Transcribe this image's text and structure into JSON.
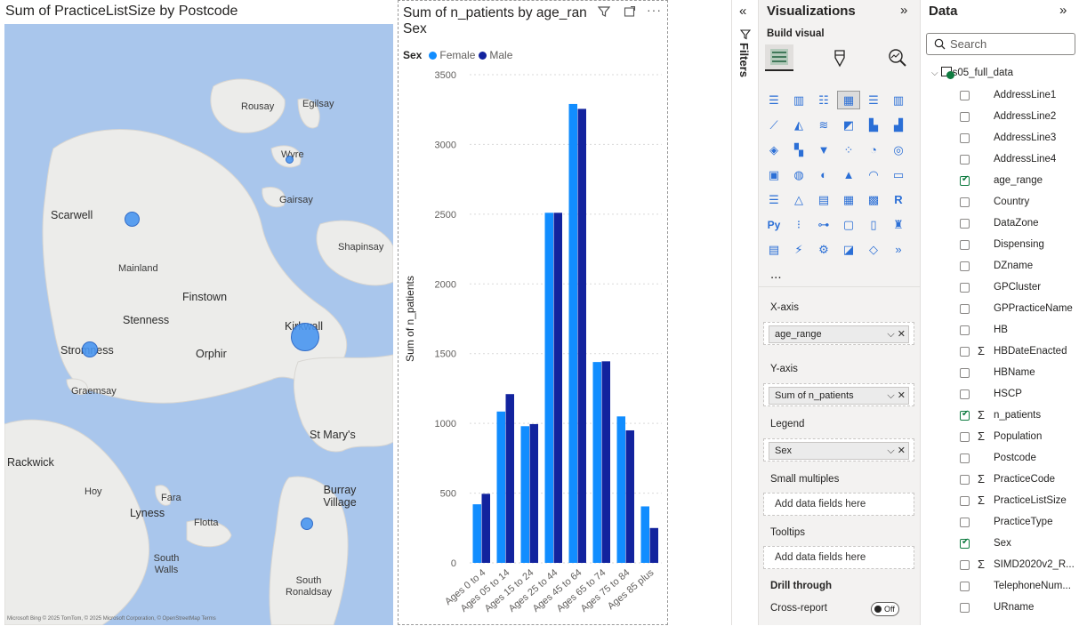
{
  "map": {
    "title": "Sum of PracticeListSize by Postcode",
    "places": [
      {
        "name": "Rousay",
        "size": "small"
      },
      {
        "name": "Egilsay",
        "size": "small"
      },
      {
        "name": "Wyre",
        "size": "small"
      },
      {
        "name": "Gairsay",
        "size": "small"
      },
      {
        "name": "Scarwell",
        "size": "big"
      },
      {
        "name": "Mainland",
        "size": "small"
      },
      {
        "name": "Shapinsay",
        "size": "small"
      },
      {
        "name": "Finstown",
        "size": "big"
      },
      {
        "name": "Stenness",
        "size": "big"
      },
      {
        "name": "Kirkwall",
        "size": "big"
      },
      {
        "name": "Stromness",
        "size": "big"
      },
      {
        "name": "Orphir",
        "size": "big"
      },
      {
        "name": "Graemsay",
        "size": "small"
      },
      {
        "name": "St Mary's",
        "size": "big"
      },
      {
        "name": "Rackwick",
        "size": "big"
      },
      {
        "name": "Burray Village",
        "size": "big"
      },
      {
        "name": "Hoy",
        "size": "small"
      },
      {
        "name": "Fara",
        "size": "small"
      },
      {
        "name": "Lyness",
        "size": "big"
      },
      {
        "name": "Flotta",
        "size": "small"
      },
      {
        "name": "South Walls",
        "size": "small"
      },
      {
        "name": "South Ronaldsay",
        "size": "small"
      }
    ],
    "footer": "Microsoft Bing    © 2025 TomTom, © 2025 Microsoft Corporation, © OpenStreetMap Terms"
  },
  "bar": {
    "title_line1": "Sum of n_patients by age_ran",
    "title_line2": "Sex",
    "legend_title": "Sex"
  },
  "chart_data": {
    "type": "bar",
    "title": "Sum of n_patients by age_range and Sex",
    "xlabel": "age_range",
    "ylabel": "Sum of n_patients",
    "ylim": [
      0,
      3500
    ],
    "yticks": [
      0,
      500,
      1000,
      1500,
      2000,
      2500,
      3000,
      3500
    ],
    "categories": [
      "Ages 0 to 4",
      "Ages 05 to 14",
      "Ages 15 to 24",
      "Ages 25 to 44",
      "Ages 45 to 64",
      "Ages 65 to 74",
      "Ages 75 to 84",
      "Ages 85 plus"
    ],
    "series": [
      {
        "name": "Female",
        "color": "#118DFF",
        "values": [
          420,
          1085,
          980,
          2510,
          3290,
          1440,
          1050,
          405
        ]
      },
      {
        "name": "Male",
        "color": "#12239E",
        "values": [
          495,
          1210,
          995,
          2510,
          3255,
          1445,
          950,
          250
        ]
      }
    ],
    "grid": true,
    "legend": "top-left"
  },
  "filters": {
    "label": "Filters",
    "collapse_icon": "double-chevron-left"
  },
  "viz": {
    "title": "Visualizations",
    "build_visual": "Build visual",
    "more": "...",
    "wells": [
      {
        "label": "X-axis",
        "value": "age_range"
      },
      {
        "label": "Y-axis",
        "value": "Sum of n_patients"
      },
      {
        "label": "Legend",
        "value": "Sex"
      },
      {
        "label": "Small multiples",
        "placeholder": "Add data fields here"
      },
      {
        "label": "Tooltips",
        "placeholder": "Add data fields here"
      }
    ],
    "drill_through": "Drill through",
    "cross_report": "Cross-report",
    "cross_report_state": "Off"
  },
  "data_pane": {
    "title": "Data",
    "search_placeholder": "Search",
    "table_name": "s05_full_data",
    "fields": [
      {
        "name": "AddressLine1",
        "checked": false,
        "sigma": false
      },
      {
        "name": "AddressLine2",
        "checked": false,
        "sigma": false
      },
      {
        "name": "AddressLine3",
        "checked": false,
        "sigma": false
      },
      {
        "name": "AddressLine4",
        "checked": false,
        "sigma": false
      },
      {
        "name": "age_range",
        "checked": true,
        "sigma": false
      },
      {
        "name": "Country",
        "checked": false,
        "sigma": false
      },
      {
        "name": "DataZone",
        "checked": false,
        "sigma": false
      },
      {
        "name": "Dispensing",
        "checked": false,
        "sigma": false
      },
      {
        "name": "DZname",
        "checked": false,
        "sigma": false
      },
      {
        "name": "GPCluster",
        "checked": false,
        "sigma": false
      },
      {
        "name": "GPPracticeName",
        "checked": false,
        "sigma": false
      },
      {
        "name": "HB",
        "checked": false,
        "sigma": false
      },
      {
        "name": "HBDateEnacted",
        "checked": false,
        "sigma": true
      },
      {
        "name": "HBName",
        "checked": false,
        "sigma": false
      },
      {
        "name": "HSCP",
        "checked": false,
        "sigma": false
      },
      {
        "name": "n_patients",
        "checked": true,
        "sigma": true
      },
      {
        "name": "Population",
        "checked": false,
        "sigma": true
      },
      {
        "name": "Postcode",
        "checked": false,
        "sigma": false
      },
      {
        "name": "PracticeCode",
        "checked": false,
        "sigma": true
      },
      {
        "name": "PracticeListSize",
        "checked": false,
        "sigma": true
      },
      {
        "name": "PracticeType",
        "checked": false,
        "sigma": false
      },
      {
        "name": "Sex",
        "checked": true,
        "sigma": false
      },
      {
        "name": "SIMD2020v2_R...",
        "checked": false,
        "sigma": true
      },
      {
        "name": "TelephoneNum...",
        "checked": false,
        "sigma": false
      },
      {
        "name": "URname",
        "checked": false,
        "sigma": false
      }
    ]
  }
}
